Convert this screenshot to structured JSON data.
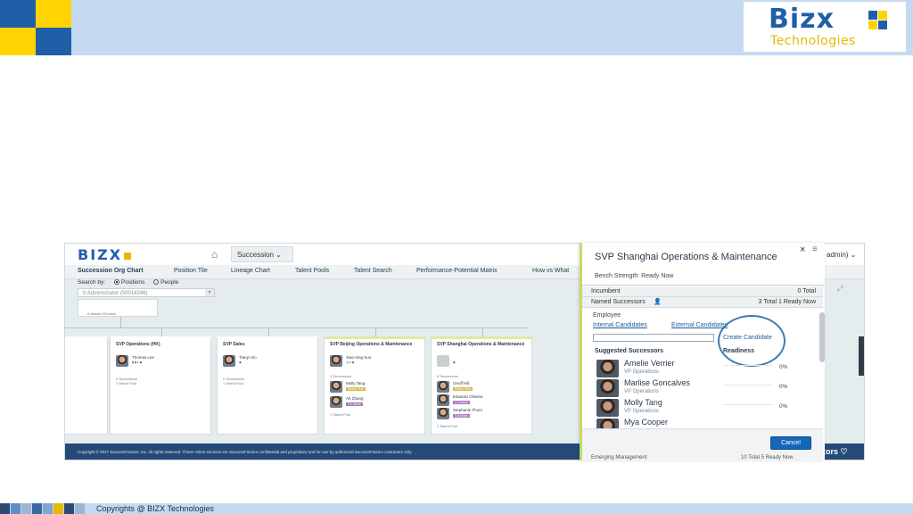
{
  "slide": {
    "brand_word": "Bizx",
    "brand_sub": "Technologies",
    "copyright": "Copyrights @ BIZX Technologies",
    "colors": {
      "header_bg": "#c5daf1",
      "brand_blue": "#1f5fa8",
      "brand_yellow": "#e6b800"
    }
  },
  "app": {
    "logo_text": "BIZX",
    "home_icon": "home-icon",
    "module_label": "Succession",
    "admin_label": "admin)",
    "tabs": [
      "Succession Org Chart",
      "Position Tile",
      "Lineage Chart",
      "Talent Pools",
      "Talent Search",
      "Performance-Potential Matrix",
      "How vs What"
    ],
    "search_by_label": "Search by:",
    "search_positions": "Positions",
    "search_people": "People",
    "search_value": "Administrator (50014346)",
    "root_count": "6 directs 704 total",
    "footer_text": "Copyright © 2017 SuccessFactors, Inc. All rights reserved. These online services are SuccessFactors confidential and proprietary and for use by authorized SuccessFactors customers only.",
    "footer_right": "tors"
  },
  "org_cards": [
    {
      "title": "SVP Operations (HK)",
      "people": [
        {
          "name": "Thomas Lee",
          "badges": "▮ ▮ ▸ ◆"
        }
      ],
      "successors": "0 Successors",
      "talent_pool": "1 Talent Pool"
    },
    {
      "title": "SVP Sales",
      "people": [
        {
          "name": "Tianyi Sio",
          "badges": "◆"
        }
      ],
      "successors": "0 Successors",
      "talent_pool": "1 Talent Pool"
    },
    {
      "title": "SVP Beijing Operations & Maintenance",
      "people": [
        {
          "name": "Xiao-ning Sun",
          "badges": "◎ ▸ ◆",
          "tag": ""
        },
        {
          "name": "Molly Tang",
          "badges": "",
          "tag": "Ready Now"
        },
        {
          "name": "Ah Zhang",
          "badges": "",
          "tag": "1-2 years"
        }
      ],
      "successors": "3 Successors",
      "talent_pool": "1 Talent Pool"
    },
    {
      "title": "SVP Shanghai Operations & Maintenance",
      "people": [
        {
          "name": "",
          "badges": "◆",
          "tag": ""
        },
        {
          "name": "Geoff Hill",
          "badges": "",
          "tag": "Ready Now"
        },
        {
          "name": "Eduardo Oliveira",
          "badges": "",
          "tag": "1-2 years"
        },
        {
          "name": "Stephanie Thom",
          "badges": "",
          "tag": "3-5 years"
        }
      ],
      "successors": "3 Successors",
      "talent_pool": "1 Talent Pool"
    }
  ],
  "panel": {
    "title": "SVP Shanghai Operations & Maintenance",
    "subtitle": "Bench Strength: Ready Now",
    "close": "×",
    "menu": "≡",
    "incumbent_label": "Incumbent",
    "incumbent_total": "0 Total",
    "named_label": "Named Successors",
    "named_total": "3 Total 1 Ready Now",
    "employee_label": "Employee",
    "internal_link": "Internal Candidates",
    "external_link": "External Candidates",
    "create_candidate": "Create Candidate",
    "col_suggested": "Suggested Successors",
    "col_readiness": "Readiness",
    "suggested": [
      {
        "name": "Amelie Verrier",
        "title": "VP Operations",
        "pct": "0%"
      },
      {
        "name": "Marlise Goncalves",
        "title": "VP Operations",
        "pct": "0%"
      },
      {
        "name": "Molly Tang",
        "title": "VP Operations",
        "pct": "0%"
      },
      {
        "name": "Mya Cooper",
        "title": "",
        "pct": ""
      }
    ],
    "cancel": "Cancel",
    "cut_left": "Emerging Management",
    "cut_right": "10 Total 5 Ready Now"
  }
}
